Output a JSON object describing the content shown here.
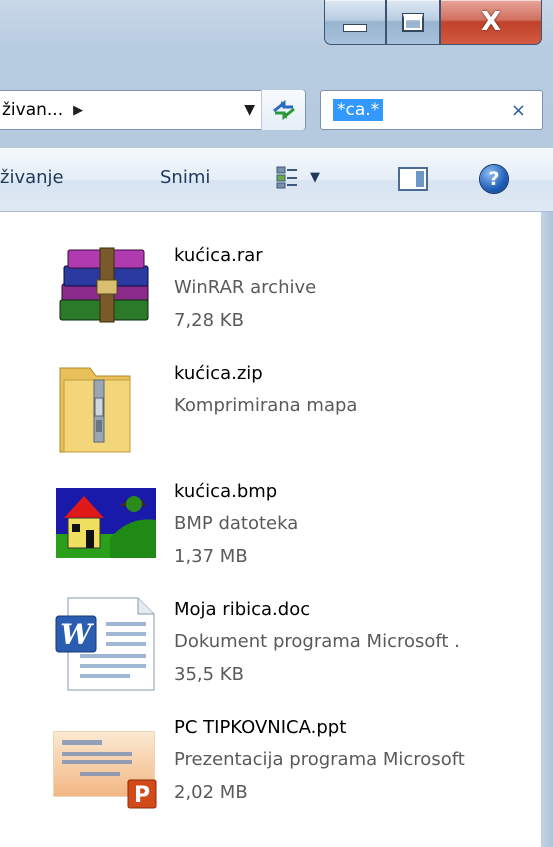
{
  "window": {
    "caption_buttons": {
      "minimize": "minimize",
      "maximize": "maximize",
      "close": "X"
    }
  },
  "address_bar": {
    "path_text": "živan...",
    "arrow": "▶",
    "dropdown": "▼"
  },
  "search": {
    "value": "*ca.*",
    "clear": "×"
  },
  "toolbar": {
    "left_label": "živanje",
    "save_label": "Snimi",
    "views_dropdown": "▼",
    "help": "?"
  },
  "files": [
    {
      "name": "kućica.rar",
      "type": "WinRAR archive",
      "size": "7,28 KB",
      "icon": "winrar-archive-icon"
    },
    {
      "name": "kućica.zip",
      "type": "Komprimirana mapa",
      "size": "",
      "icon": "zip-folder-icon"
    },
    {
      "name": "kućica.bmp",
      "type": "BMP datoteka",
      "size": "1,37 MB",
      "icon": "bmp-image-icon"
    },
    {
      "name": "Moja ribica.doc",
      "type": "Dokument programa Microsoft .",
      "size": "35,5 KB",
      "icon": "word-document-icon"
    },
    {
      "name": "PC TIPKOVNICA.ppt",
      "type": "Prezentacija programa Microsoft",
      "size": "2,02 MB",
      "icon": "powerpoint-presentation-icon"
    }
  ],
  "colors": {
    "selection": "#3399ff",
    "close_button": "#c0412b",
    "toolbar_text": "#1e395b"
  }
}
